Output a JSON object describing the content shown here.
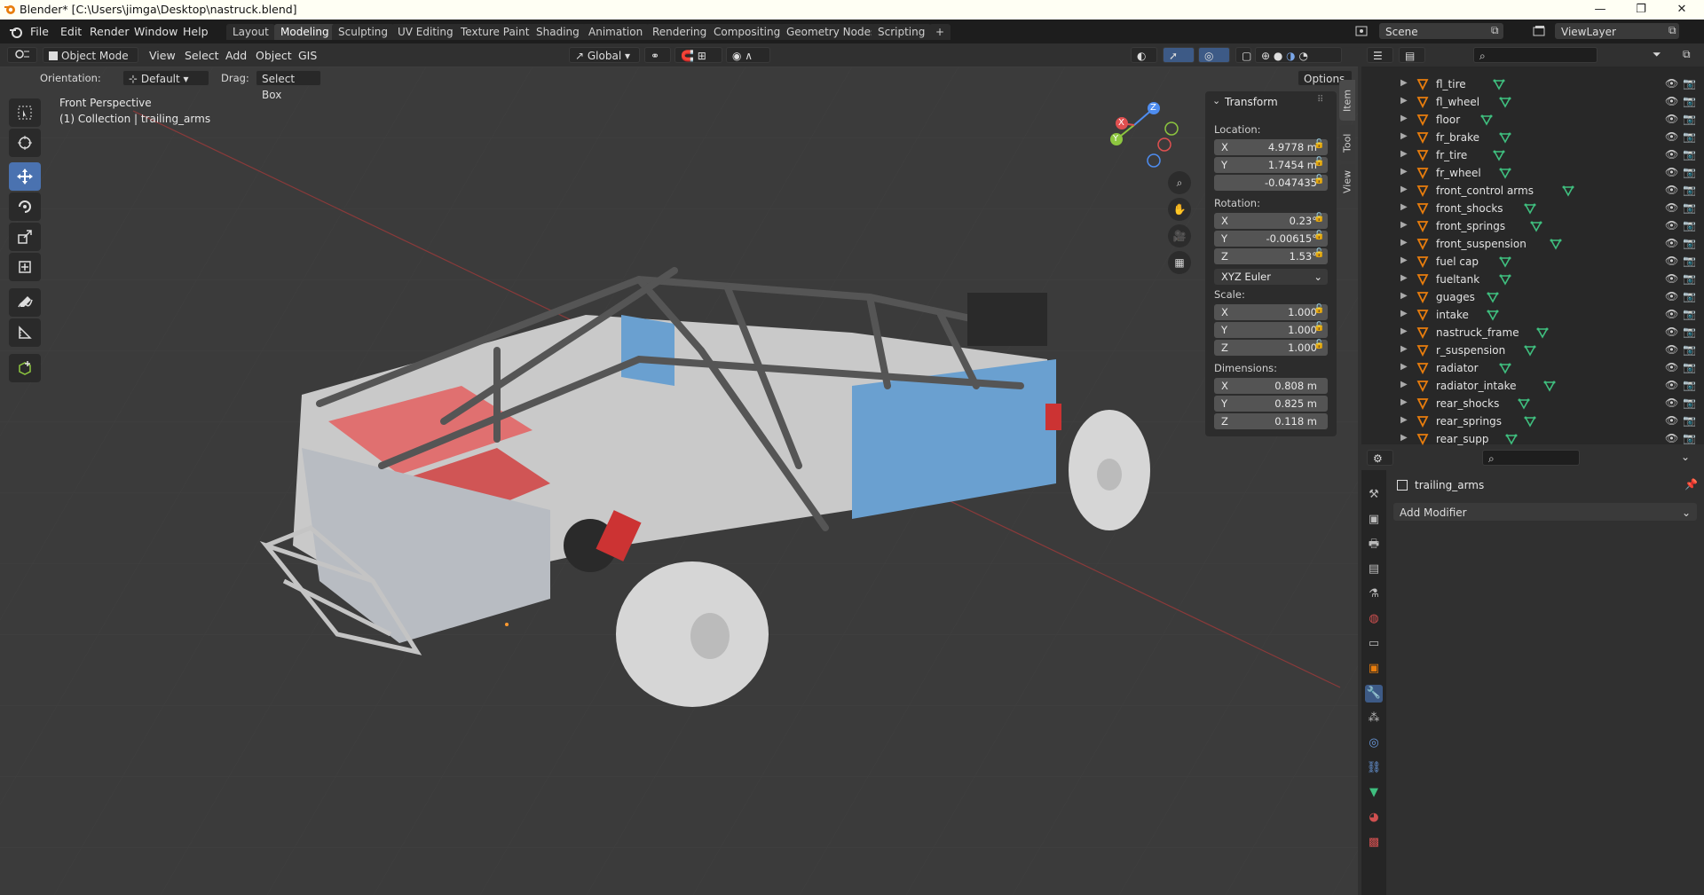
{
  "window": {
    "title": "Blender* [C:\\Users\\jimga\\Desktop\\nastruck.blend]",
    "minimize": "—",
    "maximize": "❐",
    "close": "✕"
  },
  "menus": [
    "File",
    "Edit",
    "Render",
    "Window",
    "Help"
  ],
  "workspaces": [
    "Layout",
    "Modeling",
    "Sculpting",
    "UV Editing",
    "Texture Paint",
    "Shading",
    "Animation",
    "Rendering",
    "Compositing",
    "Geometry Nodes",
    "Scripting",
    "+"
  ],
  "active_workspace": "Modeling",
  "scene": {
    "scene_name": "Scene",
    "view_layer": "ViewLayer"
  },
  "viewport_header": {
    "mode": "Object Mode",
    "menus": [
      "View",
      "Select",
      "Add",
      "Object",
      "GIS"
    ],
    "transform_orientation": "Global"
  },
  "tool_settings": {
    "orientation_label": "Orientation:",
    "orientation_value": "Default",
    "drag_label": "Drag:",
    "drag_value": "Select Box",
    "options": "Options"
  },
  "viewport": {
    "view_name": "Front Perspective",
    "collection_info": "(1) Collection | trailing_arms"
  },
  "gizmo": {
    "x": "X",
    "y": "Y",
    "z": "Z"
  },
  "npanel": {
    "tabs": [
      "Item",
      "Tool",
      "View"
    ],
    "transform_title": "Transform",
    "location_label": "Location:",
    "location": [
      {
        "axis": "X",
        "value": "4.9778 m"
      },
      {
        "axis": "Y",
        "value": "1.7454 m"
      },
      {
        "axis": "",
        "value": "-0.047435"
      }
    ],
    "rotation_label": "Rotation:",
    "rotation": [
      {
        "axis": "X",
        "value": "0.23°"
      },
      {
        "axis": "Y",
        "value": "-0.00615°"
      },
      {
        "axis": "Z",
        "value": "1.53°"
      }
    ],
    "rotation_mode": "XYZ Euler",
    "scale_label": "Scale:",
    "scale": [
      {
        "axis": "X",
        "value": "1.000"
      },
      {
        "axis": "Y",
        "value": "1.000"
      },
      {
        "axis": "Z",
        "value": "1.000"
      }
    ],
    "dimensions_label": "Dimensions:",
    "dimensions": [
      {
        "axis": "X",
        "value": "0.808 m"
      },
      {
        "axis": "Y",
        "value": "0.825 m"
      },
      {
        "axis": "Z",
        "value": "0.118 m"
      }
    ]
  },
  "outliner": {
    "items": [
      "fl_tire",
      "fl_wheel",
      "floor",
      "fr_brake",
      "fr_tire",
      "fr_wheel",
      "front_control arms",
      "front_shocks",
      "front_springs",
      "front_suspension",
      "fuel cap",
      "fueltank",
      "guages",
      "intake",
      "nastruck_frame",
      "r_suspension",
      "radiator",
      "radiator_intake",
      "rear_shocks",
      "rear_springs",
      "rear_supp"
    ]
  },
  "properties": {
    "object_name": "trailing_arms",
    "add_modifier": "Add Modifier"
  },
  "colors": {
    "accent": "#4a72b0",
    "object_orange": "#e87d0d",
    "mesh_green": "#3fbf7f"
  }
}
